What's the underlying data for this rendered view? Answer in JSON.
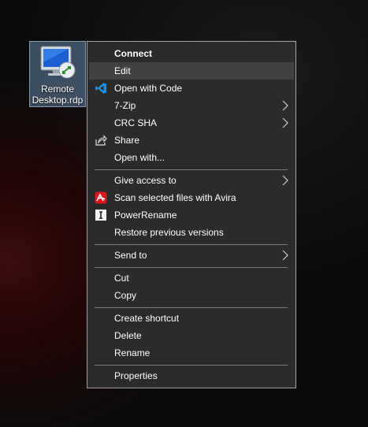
{
  "desktop_icon": {
    "label_line1": "Remote",
    "label_line2": "Desktop.rdp"
  },
  "context_menu": {
    "connect": "Connect",
    "edit": "Edit",
    "open_with_code": "Open with Code",
    "seven_zip": "7-Zip",
    "crc_sha": "CRC SHA",
    "share": "Share",
    "open_with": "Open with...",
    "give_access_to": "Give access to",
    "scan_avira": "Scan selected files with Avira",
    "power_rename": "PowerRename",
    "restore_previous": "Restore previous versions",
    "send_to": "Send to",
    "cut": "Cut",
    "copy": "Copy",
    "create_shortcut": "Create shortcut",
    "delete": "Delete",
    "rename": "Rename",
    "properties": "Properties"
  },
  "colors": {
    "menu_background": "#2b2b2b",
    "menu_hover": "#414141",
    "menu_border": "#a0a0a0",
    "vscode_blue": "#1e8fe0",
    "avira_red": "#d8161b"
  }
}
